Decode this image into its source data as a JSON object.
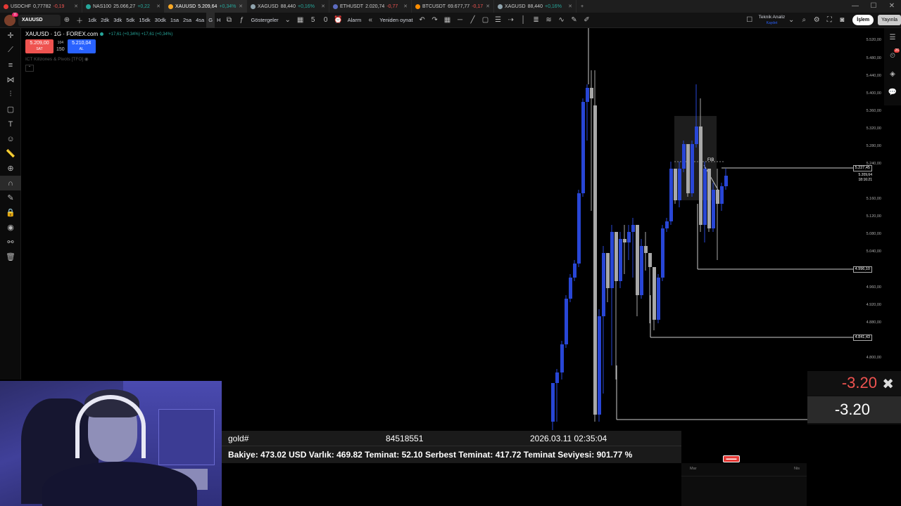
{
  "tabs": [
    {
      "symbol": "USDCHF",
      "price": "0,77782",
      "change": "-0,19",
      "neg": true,
      "color": "#e53935"
    },
    {
      "symbol": "NAS100",
      "price": "25.066,27",
      "change": "+0,22",
      "neg": false,
      "color": "#26a69a"
    },
    {
      "symbol": "XAUUSD",
      "price": "5.209,64",
      "change": "+0,34%",
      "neg": false,
      "color": "#f9a825",
      "active": true
    },
    {
      "symbol": "XAGUSD",
      "price": "88,440",
      "change": "+0,16%",
      "neg": false,
      "color": "#90a4ae"
    },
    {
      "symbol": "ETHUSDT",
      "price": "2.020,74",
      "change": "-0,77",
      "neg": true,
      "color": "#5c6bc0"
    },
    {
      "symbol": "BTCUSDT",
      "price": "69.677,77",
      "change": "-0,17",
      "neg": true,
      "color": "#fb8c00"
    },
    {
      "symbol": "XAGUSD",
      "price": "88,440",
      "change": "+0,16%",
      "neg": false,
      "color": "#90a4ae"
    }
  ],
  "toolbar": {
    "avatar_badge": "11",
    "symbol": "XAUUSD",
    "intervals": [
      "1dk",
      "2dk",
      "3dk",
      "5dk",
      "15dk",
      "30dk",
      "1sa",
      "2sa",
      "4sa",
      "G",
      "H"
    ],
    "indicators_label": "Göstergeler",
    "count_a": "5",
    "count_b": "0",
    "alarm_label": "Alarm",
    "replay_label": "Yeniden oynat",
    "analysis_title": "Teknik Analiz",
    "analysis_sub": "Kaydet",
    "trade_label": "İşlem",
    "publish_label": "Yayınla"
  },
  "legend": {
    "title": "XAUUSD · 1G · FOREX.com",
    "change": "+17,61 (+0,34%) +17,61 (+0,34%)",
    "sell_price": "5.209,00",
    "sell_label": "SAT",
    "spread_top": "104",
    "spread": "150",
    "buy_price": "5.210,04",
    "buy_label": "AL",
    "indicator": "ICT Killzones & Pivots [TFO]"
  },
  "right_panel": {
    "alert_badge": "26"
  },
  "price_axis": {
    "ticks": [
      "5.520,00",
      "5.480,00",
      "5.440,00",
      "5.400,00",
      "5.360,00",
      "5.320,00",
      "5.280,00",
      "5.240,00",
      "5.209,64",
      "5.160,00",
      "5.120,00",
      "5.080,00",
      "5.040,00",
      "4.996,10",
      "4.960,00",
      "4.920,00",
      "4.880,00",
      "4.841,43",
      "4.800,00"
    ],
    "label_upper": "5.227,45",
    "current": "5.209,64",
    "countdown": "18:16:21",
    "label_mid": "4.996,10",
    "label_low": "4.841,43"
  },
  "fib_label": "FIB",
  "chart_data": {
    "type": "candlestick",
    "ylim": [
      4720,
      5540
    ]
  },
  "trade_panel": {
    "symbol": "gold#",
    "ticket": "84518551",
    "time": "2026.03.11 02:35:04",
    "summary": "Bakiye: 473.02 USD  Varlık: 469.82  Teminat: 52.10  Serbest Teminat: 417.72  Teminat Seviyesi: 901.77 %"
  },
  "pnl": {
    "value1": "-3.20",
    "value2": "-3.20"
  },
  "time_axis": {
    "label1": "Mar",
    "label2": "Nis"
  },
  "flag_text": "▬▬▬"
}
